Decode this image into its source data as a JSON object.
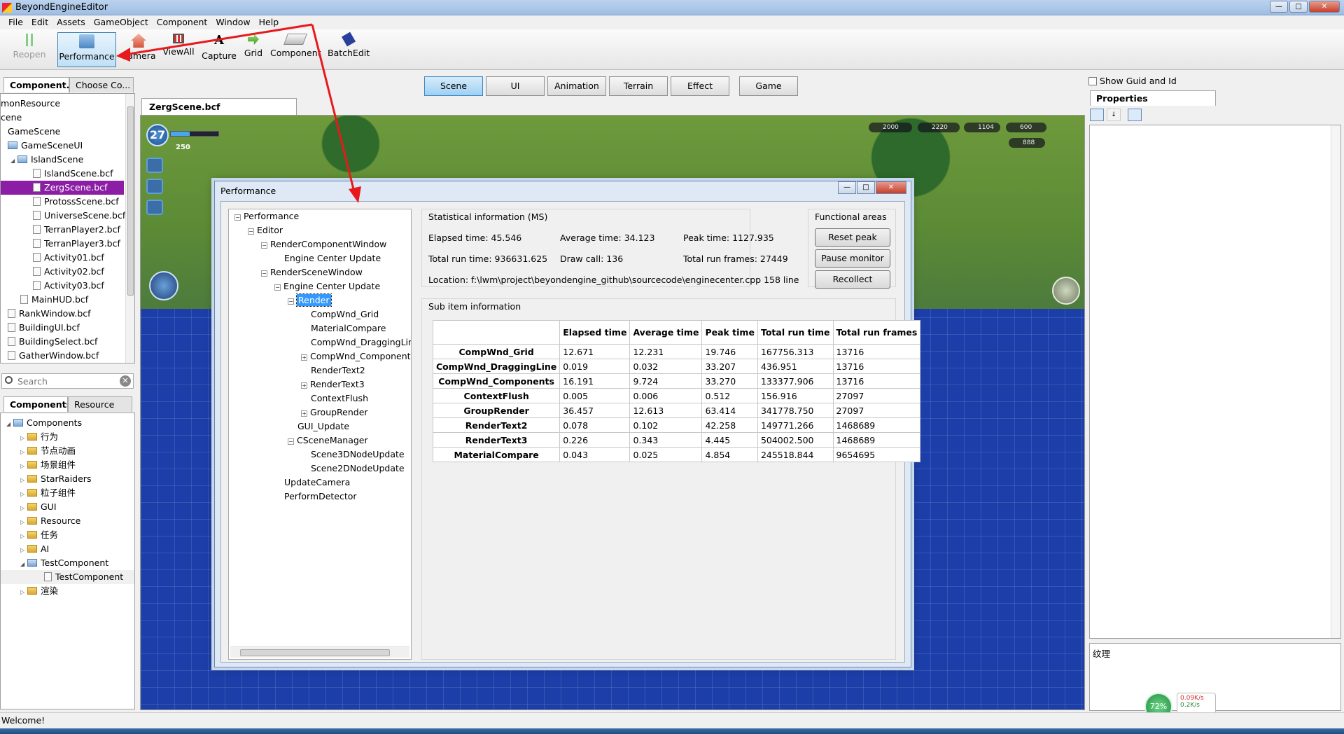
{
  "window": {
    "title": "BeyondEngineEditor"
  },
  "menu": [
    "File",
    "Edit",
    "Assets",
    "GameObject",
    "Component",
    "Window",
    "Help"
  ],
  "toolbar": {
    "reopen": "Reopen",
    "performance": "Performance",
    "camera": "Camera",
    "viewall": "ViewAll",
    "capture": "Capture",
    "grid": "Grid",
    "component": "Component",
    "batchedit": "BatchEdit"
  },
  "left_top": {
    "tabs": [
      "Component...",
      "Choose Co..."
    ],
    "items": [
      "monResource",
      "cene",
      "GameScene",
      "GameSceneUI",
      "IslandScene",
      "IslandScene.bcf",
      "ZergScene.bcf",
      "ProtossScene.bcf",
      "UniverseScene.bcf",
      "TerranPlayer2.bcf",
      "TerranPlayer3.bcf",
      "Activity01.bcf",
      "Activity02.bcf",
      "Activity03.bcf",
      "MainHUD.bcf",
      "RankWindow.bcf",
      "BuildingUI.bcf",
      "BuildingSelect.bcf",
      "GatherWindow.bcf"
    ],
    "search_placeholder": "Search"
  },
  "left_bottom": {
    "tabs": [
      "Components",
      "Resource"
    ],
    "items": [
      "Components",
      "行为",
      "节点动画",
      "场景组件",
      "StarRaiders",
      "粒子组件",
      "GUI",
      "Resource",
      "任务",
      "AI",
      "TestComponent",
      "TestComponent",
      "渲染"
    ]
  },
  "scene_tabs": [
    "Scene",
    "UI",
    "Animation",
    "Terrain",
    "Effect",
    "Game"
  ],
  "doc_tab": "ZergScene.bcf",
  "game_hud": {
    "level": "27",
    "coins": "250",
    "gold": "2000",
    "water": "2220",
    "green": "1104",
    "purple": "600",
    "gems": "888"
  },
  "performance": {
    "title": "Performance",
    "tree": [
      "Performance",
      "Editor",
      "RenderComponentWindow",
      "Engine Center Update",
      "RenderSceneWindow",
      "Engine Center Update",
      "Render",
      "CompWnd_Grid",
      "MaterialCompare",
      "CompWnd_DraggingLin",
      "CompWnd_Component",
      "RenderText2",
      "RenderText3",
      "ContextFlush",
      "GroupRender",
      "GUI_Update",
      "CSceneManager",
      "Scene3DNodeUpdate",
      "Scene2DNodeUpdate",
      "UpdateCamera",
      "PerformDetector"
    ],
    "stat_label": "Statistical information (MS)",
    "elapsed": "Elapsed time:  45.546",
    "average": "Average time:  34.123",
    "peak": "Peak time:  1127.935",
    "total_run": "Total run time:  936631.625",
    "draw_call": "Draw call:  136",
    "total_frames": "Total run frames:  27449",
    "location": "Location:   f:\\lwm\\project\\beyondengine_github\\sourcecode\\enginecenter.cpp 158 line",
    "func_label": "Functional areas",
    "reset_peak": "Reset peak",
    "pause_monitor": "Pause monitor",
    "recollect": "Recollect",
    "sub_label": "Sub item information",
    "columns": [
      "",
      "Elapsed time",
      "Average time",
      "Peak time",
      "Total run time",
      "Total run frames"
    ],
    "rows": [
      [
        "CompWnd_Grid",
        "12.671",
        "12.231",
        "19.746",
        "167756.313",
        "13716"
      ],
      [
        "CompWnd_DraggingLine",
        "0.019",
        "0.032",
        "33.207",
        "436.951",
        "13716"
      ],
      [
        "CompWnd_Components",
        "16.191",
        "9.724",
        "33.270",
        "133377.906",
        "13716"
      ],
      [
        "ContextFlush",
        "0.005",
        "0.006",
        "0.512",
        "156.916",
        "27097"
      ],
      [
        "GroupRender",
        "36.457",
        "12.613",
        "63.414",
        "341778.750",
        "27097"
      ],
      [
        "RenderText2",
        "0.078",
        "0.102",
        "42.258",
        "149771.266",
        "1468689"
      ],
      [
        "RenderText3",
        "0.226",
        "0.343",
        "4.445",
        "504002.500",
        "1468689"
      ],
      [
        "MaterialCompare",
        "0.043",
        "0.025",
        "4.854",
        "245518.844",
        "9654695"
      ]
    ]
  },
  "right": {
    "show_guid": "Show Guid and Id",
    "properties_tab": "Properties",
    "texture_label": "纹理",
    "net_up": "0.09K/s",
    "net_down": "0.2K/s",
    "cpu": "72%"
  },
  "status": "Welcome!",
  "colors": {
    "selection": "#8c1ea6",
    "tree_highlight": "#3399ff",
    "annotation": "#e8191c"
  }
}
